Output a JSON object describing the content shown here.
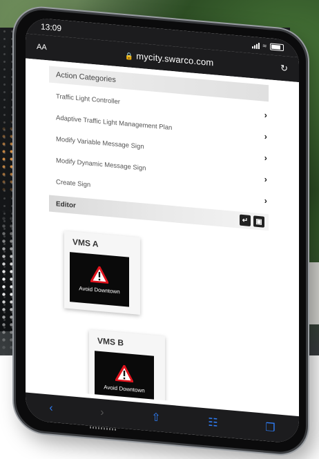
{
  "status": {
    "time": "13:09"
  },
  "browser": {
    "text_size_label": "AA",
    "url": "mycity.swarco.com"
  },
  "categories": {
    "header": "Action Categories",
    "items": [
      {
        "label": "Traffic Light Controller"
      },
      {
        "label": "Adaptive Traffic Light Management Plan"
      },
      {
        "label": "Modify Variable Message Sign"
      },
      {
        "label": "Modify Dynamic Message Sign"
      },
      {
        "label": "Create Sign"
      }
    ]
  },
  "editor": {
    "title": "Editor"
  },
  "signs": [
    {
      "title": "VMS A",
      "message": "Avoid Downtown"
    },
    {
      "title": "VMS B",
      "message": "Avoid Downtown"
    }
  ],
  "colors": {
    "browser_chrome": "#1c1c1e",
    "toolbar_accent": "#2f7df6",
    "warning_red": "#e0141e"
  },
  "icons": {
    "toolbar": [
      "back-icon",
      "forward-icon",
      "share-icon",
      "bookmarks-icon",
      "tabs-icon"
    ],
    "editor_tools": [
      "export-icon",
      "lock-icon"
    ]
  }
}
